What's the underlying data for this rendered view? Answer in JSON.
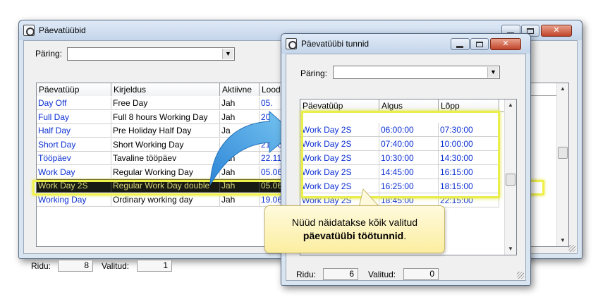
{
  "main_window": {
    "title": "Päevatüübid",
    "query_label": "Päring:",
    "query_value": "",
    "columns": [
      "Päevatüüp",
      "Kirjeldus",
      "Aktiivne",
      "Loodu"
    ],
    "rows": [
      {
        "type": "Day Off",
        "desc": "Free Day",
        "active": "Jah",
        "created": "05."
      },
      {
        "type": "Full Day",
        "desc": "Full 8 hours Working Day",
        "active": "Jah",
        "created": "20."
      },
      {
        "type": "Half Day",
        "desc": "Pre Holiday Half Day",
        "active": "Ja",
        "created": "05."
      },
      {
        "type": "Short Day",
        "desc": "Short Working Day",
        "active": "",
        "created": "21.06"
      },
      {
        "type": "Tööpäev",
        "desc": "Tavaline tööpäev",
        "active": "Jah",
        "created": "22.11"
      },
      {
        "type": "Work Day",
        "desc": "Regular Working Day",
        "active": "Jah",
        "created": "05.06"
      },
      {
        "type": "Work Day 2S",
        "desc": "Regular Work Day double",
        "active": "Jah",
        "created": "05.06"
      },
      {
        "type": "Working Day",
        "desc": "Ordinary working day",
        "active": "Jah",
        "created": "19.06"
      }
    ],
    "selected_row": 6,
    "status": {
      "rows_label": "Ridu:",
      "rows_value": "8",
      "selected_label": "Valitud:",
      "selected_value": "1"
    }
  },
  "detail_window": {
    "title": "Päevatüübi tunnid",
    "query_label": "Päring:",
    "query_value": "",
    "columns": [
      "Päevatüüp",
      "Algus",
      "Lõpp"
    ],
    "rows": [
      {
        "type": "Work Day 2S",
        "start": "06:00:00",
        "end": "07:30:00"
      },
      {
        "type": "Work Day 2S",
        "start": "07:40:00",
        "end": "10:00:00"
      },
      {
        "type": "Work Day 2S",
        "start": "10:30:00",
        "end": "14:30:00"
      },
      {
        "type": "Work Day 2S",
        "start": "14:45:00",
        "end": "16:15:00"
      },
      {
        "type": "Work Day 2S",
        "start": "16:25:00",
        "end": "18:15:00"
      },
      {
        "type": "Work Day 2S",
        "start": "18:45:00",
        "end": "22:15:00"
      }
    ],
    "status": {
      "rows_label": "Ridu:",
      "rows_value": "6",
      "selected_label": "Valitud:",
      "selected_value": "0"
    }
  },
  "callout": {
    "line1": "Nüüd näidatakse kõik valitud",
    "line2_bold": "päevatüübi töötunnid",
    "line2_tail": "."
  },
  "colors": {
    "highlight": "#f0f14a",
    "link_blue": "#0b2fd2",
    "arrow_blue": "#3aa0e6",
    "callout_bg": "#fbeea0"
  }
}
